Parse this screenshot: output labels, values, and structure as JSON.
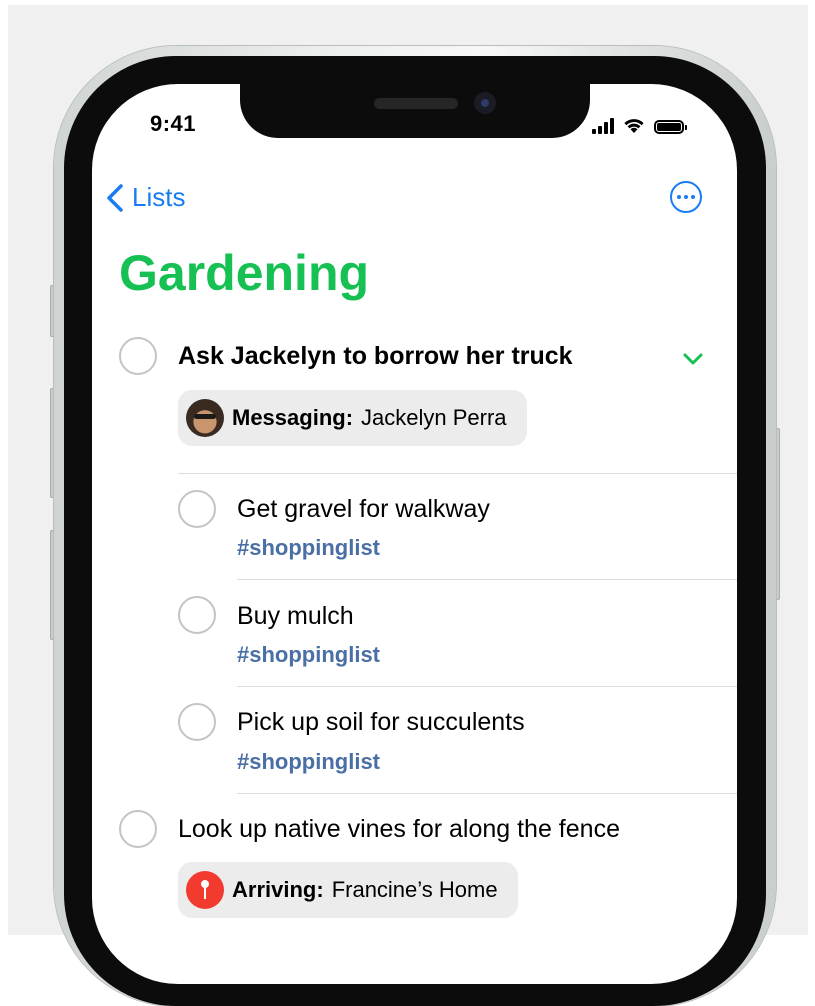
{
  "status_bar": {
    "time": "9:41"
  },
  "nav": {
    "back_label": "Lists"
  },
  "list": {
    "title": "Gardening",
    "accent_color": "#16c053",
    "tasks": [
      {
        "title": "Ask Jackelyn to borrow her truck",
        "chip": {
          "label": "Messaging:",
          "value": "Jackelyn Perra",
          "icon": "avatar"
        },
        "subtasks": [
          {
            "title": "Get gravel for walkway",
            "tag": "#shoppinglist"
          },
          {
            "title": "Buy mulch",
            "tag": "#shoppinglist"
          },
          {
            "title": "Pick up soil for succulents",
            "tag": "#shoppinglist"
          }
        ]
      },
      {
        "title": "Look up native vines for along the fence",
        "chip": {
          "label": "Arriving:",
          "value": "Francine’s Home",
          "icon": "location-pin-icon"
        }
      }
    ]
  },
  "colors": {
    "link_blue": "#1a7cf2",
    "tag_blue": "#4a6fa5",
    "chip_bg": "#ececed"
  }
}
